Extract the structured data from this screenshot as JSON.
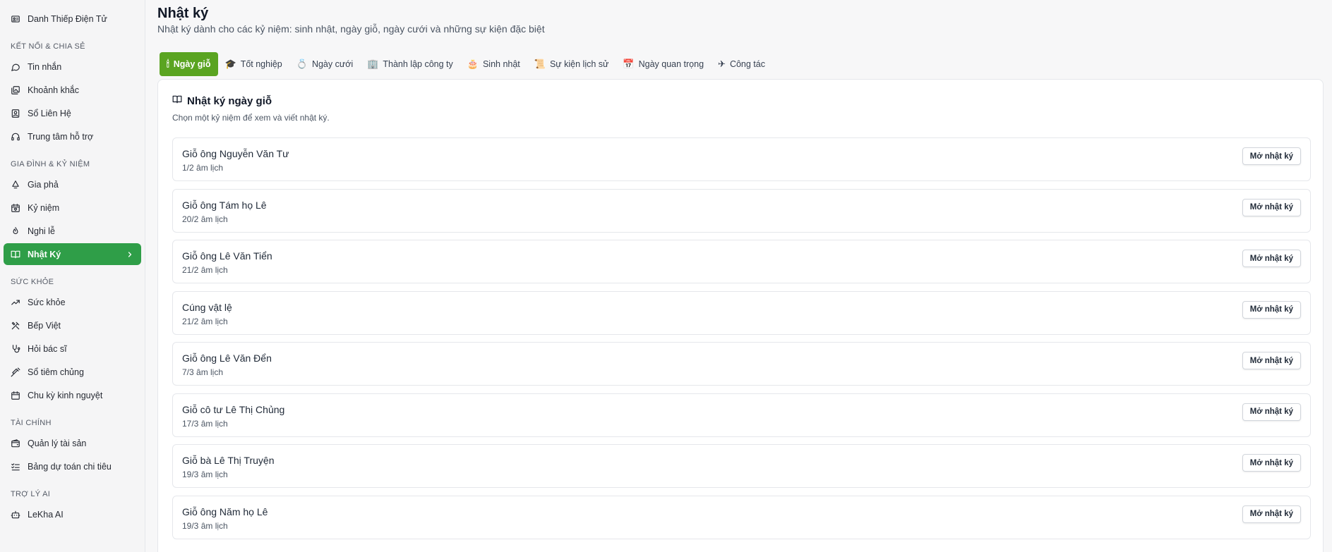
{
  "sidebar": {
    "items": [
      {
        "label": "Danh Thiếp Điện Tử",
        "icon": "card-icon"
      },
      {
        "section": "KẾT NỐI & CHIA SẺ"
      },
      {
        "label": "Tin nhắn",
        "icon": "message-icon"
      },
      {
        "label": "Khoảnh khắc",
        "icon": "gallery-icon"
      },
      {
        "label": "Sổ Liên Hệ",
        "icon": "contacts-icon"
      },
      {
        "label": "Trung tâm hỗ trợ",
        "icon": "headset-icon"
      },
      {
        "section": "GIA ĐÌNH & KỶ NIỆM"
      },
      {
        "label": "Gia phả",
        "icon": "tree-icon"
      },
      {
        "label": "Kỷ niệm",
        "icon": "calendar-heart-icon"
      },
      {
        "label": "Nghi lễ",
        "icon": "flame-icon"
      },
      {
        "label": "Nhật Ký",
        "icon": "book-icon",
        "active": true
      },
      {
        "section": "SỨC KHỎE"
      },
      {
        "label": "Sức khỏe",
        "icon": "trend-icon"
      },
      {
        "label": "Bếp Việt",
        "icon": "utensils-icon"
      },
      {
        "label": "Hỏi bác sĩ",
        "icon": "stethoscope-icon"
      },
      {
        "label": "Sổ tiêm chủng",
        "icon": "syringe-icon"
      },
      {
        "label": "Chu kỳ kinh nguyệt",
        "icon": "calendar-icon"
      },
      {
        "section": "TÀI CHÍNH"
      },
      {
        "label": "Quản lý tài sản",
        "icon": "wallet-icon"
      },
      {
        "label": "Bảng dự toán chi tiêu",
        "icon": "checklist-icon"
      },
      {
        "section": "TRỢ LÝ AI"
      },
      {
        "label": "LeKha AI",
        "icon": "bot-icon"
      }
    ]
  },
  "page": {
    "title": "Nhật ký",
    "subtitle": "Nhật ký dành cho các kỷ niệm: sinh nhật, ngày giỗ, ngày cưới và những sự kiện đặc biệt"
  },
  "tabs": [
    {
      "label": "Ngày giỗ",
      "icon": "🕯",
      "name": "candle-icon",
      "active": true
    },
    {
      "label": "Tốt nghiệp",
      "icon": "🎓",
      "name": "graduation-cap-icon"
    },
    {
      "label": "Ngày cưới",
      "icon": "💍",
      "name": "ring-icon"
    },
    {
      "label": "Thành lập công ty",
      "icon": "🏢",
      "name": "office-building-icon"
    },
    {
      "label": "Sinh nhật",
      "icon": "🎂",
      "name": "birthday-cake-icon"
    },
    {
      "label": "Sự kiện lịch sử",
      "icon": "📜",
      "name": "scroll-icon"
    },
    {
      "label": "Ngày quan trọng",
      "icon": "📅",
      "name": "calendar-icon"
    },
    {
      "label": "Công tác",
      "icon": "✈",
      "name": "airplane-icon"
    }
  ],
  "card": {
    "title": "Nhật ký ngày giỗ",
    "description": "Chọn một kỷ niệm để xem và viết nhật ký.",
    "open_label": "Mở nhật ký",
    "entries": [
      {
        "title": "Giỗ ông Nguyễn Văn Tư",
        "date": "1/2 âm lịch"
      },
      {
        "title": "Giỗ ông Tám họ Lê",
        "date": "20/2 âm lịch"
      },
      {
        "title": "Giỗ ông Lê Văn Tiển",
        "date": "21/2 âm lịch"
      },
      {
        "title": "Cúng vật lệ",
        "date": "21/2 âm lịch"
      },
      {
        "title": "Giỗ ông Lê Văn Đển",
        "date": "7/3 âm lịch"
      },
      {
        "title": "Giỗ cô tư Lê Thị Chủng",
        "date": "17/3 âm lịch"
      },
      {
        "title": "Giỗ bà Lê Thị Truyện",
        "date": "19/3 âm lịch"
      },
      {
        "title": "Giỗ ông Năm họ Lê",
        "date": "19/3 âm lịch"
      }
    ]
  },
  "colors": {
    "sidebar_active": "#2f9e48",
    "tab_active": "#5aa421"
  }
}
